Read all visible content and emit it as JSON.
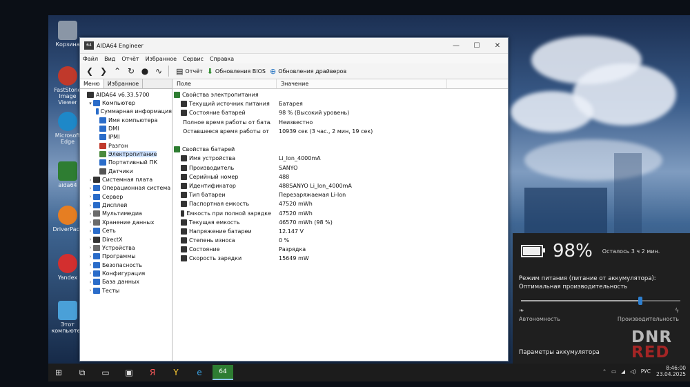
{
  "window": {
    "title": "AIDA64 Engineer",
    "app_icon": "64",
    "minimize": "—",
    "maximize": "☐",
    "close": "✕"
  },
  "menu": [
    "Файл",
    "Вид",
    "Отчёт",
    "Избранное",
    "Сервис",
    "Справка"
  ],
  "toolbar": {
    "report": "Отчёт",
    "bios_updates": "Обновления BIOS",
    "driver_updates": "Обновления драйверов"
  },
  "left_tabs": [
    "Меню",
    "Избранное"
  ],
  "tree": [
    {
      "label": "AIDA64 v6.33.5700",
      "level": 0,
      "exp": "",
      "color": "#333333"
    },
    {
      "label": "Компьютер",
      "level": 1,
      "exp": "v",
      "color": "#2a6cc9"
    },
    {
      "label": "Суммарная информация",
      "level": 2,
      "exp": "",
      "color": "#2a6cc9"
    },
    {
      "label": "Имя компьютера",
      "level": 2,
      "exp": "",
      "color": "#2a6cc9"
    },
    {
      "label": "DMI",
      "level": 2,
      "exp": "",
      "color": "#2a6cc9"
    },
    {
      "label": "IPMI",
      "level": 2,
      "exp": "",
      "color": "#2a6cc9"
    },
    {
      "label": "Разгон",
      "level": 2,
      "exp": "",
      "color": "#c0392b"
    },
    {
      "label": "Электропитание",
      "level": 2,
      "exp": "",
      "color": "#4a8a3c",
      "selected": true
    },
    {
      "label": "Портативный ПК",
      "level": 2,
      "exp": "",
      "color": "#2a6cc9"
    },
    {
      "label": "Датчики",
      "level": 2,
      "exp": "",
      "color": "#555555"
    },
    {
      "label": "Системная плата",
      "level": 1,
      "exp": ">",
      "color": "#333333"
    },
    {
      "label": "Операционная система",
      "level": 1,
      "exp": ">",
      "color": "#2a6cc9"
    },
    {
      "label": "Сервер",
      "level": 1,
      "exp": ">",
      "color": "#2a6cc9"
    },
    {
      "label": "Дисплей",
      "level": 1,
      "exp": ">",
      "color": "#2a6cc9"
    },
    {
      "label": "Мультимедиа",
      "level": 1,
      "exp": ">",
      "color": "#6a6a6a"
    },
    {
      "label": "Хранение данных",
      "level": 1,
      "exp": ">",
      "color": "#6a6a6a"
    },
    {
      "label": "Сеть",
      "level": 1,
      "exp": ">",
      "color": "#2a6cc9"
    },
    {
      "label": "DirectX",
      "level": 1,
      "exp": ">",
      "color": "#333333"
    },
    {
      "label": "Устройства",
      "level": 1,
      "exp": ">",
      "color": "#6a6a6a"
    },
    {
      "label": "Программы",
      "level": 1,
      "exp": ">",
      "color": "#2a6cc9"
    },
    {
      "label": "Безопасность",
      "level": 1,
      "exp": ">",
      "color": "#2a6cc9"
    },
    {
      "label": "Конфигурация",
      "level": 1,
      "exp": ">",
      "color": "#2a6cc9"
    },
    {
      "label": "База данных",
      "level": 1,
      "exp": ">",
      "color": "#2a6cc9"
    },
    {
      "label": "Тесты",
      "level": 1,
      "exp": ">",
      "color": "#2a6cc9"
    }
  ],
  "columns": {
    "field": "Поле",
    "value": "Значение"
  },
  "rows": [
    {
      "type": "section",
      "field": "Свойства электропитания",
      "value": ""
    },
    {
      "type": "item",
      "field": "Текущий источник питания",
      "value": "Батарея"
    },
    {
      "type": "item",
      "field": "Состояние батарей",
      "value": "98 % (Высокий уровень)"
    },
    {
      "type": "item",
      "field": "Полное время работы от бата...",
      "value": "Неизвестно"
    },
    {
      "type": "item",
      "field": "Оставшееся время работы от ...",
      "value": "10939 сек (3 час., 2 мин, 19 сек)"
    },
    {
      "type": "blank",
      "field": "",
      "value": ""
    },
    {
      "type": "section",
      "field": "Свойства батарей",
      "value": ""
    },
    {
      "type": "item",
      "field": "Имя устройства",
      "value": "Li_Ion_4000mA"
    },
    {
      "type": "item",
      "field": "Производитель",
      "value": "SANYO"
    },
    {
      "type": "item",
      "field": "Серийный номер",
      "value": "488"
    },
    {
      "type": "item",
      "field": "Идентификатор",
      "value": "488SANYO Li_Ion_4000mA"
    },
    {
      "type": "item",
      "field": "Тип батареи",
      "value": "Перезаряжаемая Li-Ion"
    },
    {
      "type": "item",
      "field": "Паспортная емкость",
      "value": "47520 mWh"
    },
    {
      "type": "item",
      "field": "Емкость при полной зарядке",
      "value": "47520 mWh"
    },
    {
      "type": "item",
      "field": "Текущая емкость",
      "value": "46570 mWh  (98 %)"
    },
    {
      "type": "item",
      "field": "Напряжение батареи",
      "value": "12.147 V"
    },
    {
      "type": "item",
      "field": "Степень износа",
      "value": "0 %"
    },
    {
      "type": "item",
      "field": "Состояние",
      "value": "Разрядка"
    },
    {
      "type": "item",
      "field": "Скорость зарядки",
      "value": "15649 mW"
    }
  ],
  "battery_flyout": {
    "percent": "98%",
    "level": 0.98,
    "remaining": "Осталось 3 ч 2 мин.",
    "mode_label": "Режим питания (питание от аккумулятора):",
    "mode_value": "Оптимальная производительность",
    "slider_position": 0.75,
    "left_label": "Автономность",
    "right_label": "Производительность",
    "settings": "Параметры аккумулятора"
  },
  "desktop_icons": [
    {
      "label": "Корзина",
      "color": "#8a96a6"
    },
    {
      "label": "FastStone Image Viewer",
      "color": "#c0392b"
    },
    {
      "label": "Microsoft Edge",
      "color": "#1e88c8"
    },
    {
      "label": "aida64",
      "color": "#2e7d32"
    },
    {
      "label": "DriverPack",
      "color": "#e67e22"
    },
    {
      "label": "Yandex",
      "color": "#d32f2f"
    },
    {
      "label": "Этот компьютер",
      "color": "#4aa0d8"
    }
  ],
  "taskbar": {
    "items": [
      "⊞",
      "⧉",
      "▭",
      "▣",
      "Я",
      "Y",
      "e",
      "64"
    ],
    "language": "РУС",
    "time": "8:46:00",
    "date": "23.04.2025"
  },
  "watermark": {
    "line1": "DNR",
    "line2": "RED"
  }
}
